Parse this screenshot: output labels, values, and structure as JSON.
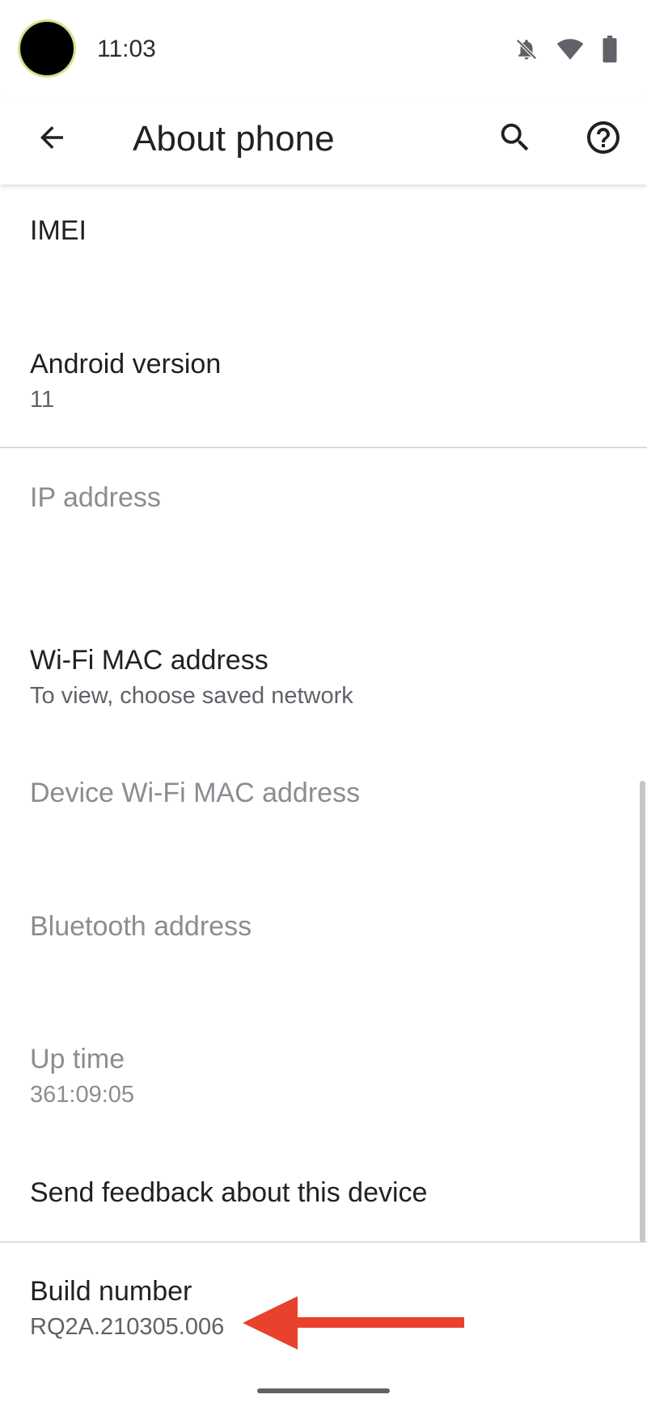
{
  "status_bar": {
    "time": "11:03",
    "icons": [
      "notifications-off-icon",
      "wifi-icon",
      "battery-icon"
    ]
  },
  "app_bar": {
    "title": "About phone",
    "back_icon": "arrow-back-icon",
    "search_icon": "search-icon",
    "help_icon": "help-icon"
  },
  "preferences": [
    {
      "title": "IMEI",
      "summary": "",
      "enabled": true
    },
    {
      "title": "Android version",
      "summary": "11",
      "enabled": true
    },
    {
      "title": "IP address",
      "summary": "",
      "enabled": false
    },
    {
      "title": "Wi-Fi MAC address",
      "summary": "To view, choose saved network",
      "enabled": true
    },
    {
      "title": "Device Wi-Fi MAC address",
      "summary": "",
      "enabled": false
    },
    {
      "title": "Bluetooth address",
      "summary": "",
      "enabled": false
    },
    {
      "title": "Up time",
      "summary": "361:09:05",
      "enabled": false
    },
    {
      "title": "Send feedback about this device",
      "summary": "",
      "enabled": true
    },
    {
      "title": "Build number",
      "summary": "RQ2A.210305.006",
      "enabled": true
    }
  ],
  "colors": {
    "annotation_arrow": "#e8412c",
    "text_primary": "#202124",
    "text_secondary": "#5f6368",
    "text_disabled": "#8a8d91",
    "divider": "#dadce0"
  }
}
